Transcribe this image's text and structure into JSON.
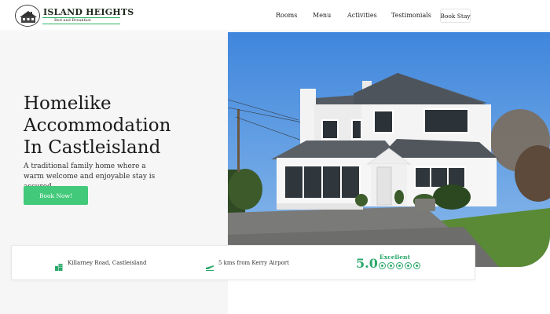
{
  "brand": {
    "title": "ISLAND HEIGHTS",
    "subtitle": "Bed and Breakfast"
  },
  "nav": {
    "items": [
      {
        "label": "Rooms"
      },
      {
        "label": "Menu"
      },
      {
        "label": "Activities"
      },
      {
        "label": "Testimonials"
      }
    ],
    "book_stay": "Book Stay"
  },
  "hero": {
    "title_lines": [
      "Homelike",
      "Accommodation",
      "In Castleisland"
    ],
    "description": "A traditional family home where a warm welcome and enjoyable stay is assured.",
    "cta": "Book Now!"
  },
  "info": {
    "address": "Killarney Road, Castleisland",
    "airport": "5 kms from Kerry Airport",
    "rating_score": "5.0",
    "rating_label": "Excellent",
    "rating_dots": 5
  },
  "colors": {
    "accent": "#42c97a",
    "accent_dark": "#2aa86a"
  },
  "icons": {
    "address": "buildings-icon",
    "airport": "plane-icon",
    "rating": "tripadvisor-dot-icon"
  }
}
